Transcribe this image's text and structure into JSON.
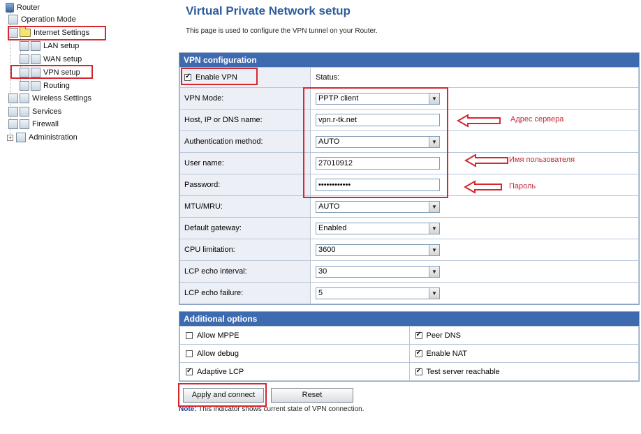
{
  "sidebar": {
    "items": [
      {
        "label": "Router",
        "icon": "router-icon"
      },
      {
        "label": "Operation Mode",
        "icon": "page-icon"
      },
      {
        "label": "Internet Settings",
        "icon": "folder-icon"
      },
      {
        "label": "LAN setup",
        "icon": "page-icon"
      },
      {
        "label": "WAN setup",
        "icon": "page-icon"
      },
      {
        "label": "VPN setup",
        "icon": "page-icon"
      },
      {
        "label": "Routing",
        "icon": "page-icon"
      },
      {
        "label": "Wireless Settings",
        "icon": "page-icon"
      },
      {
        "label": "Services",
        "icon": "page-icon"
      },
      {
        "label": "Firewall",
        "icon": "page-icon"
      },
      {
        "label": "Administration",
        "icon": "page-icon"
      }
    ],
    "expand_glyph": "+"
  },
  "page": {
    "title": "Virtual Private Network setup",
    "intro": "This page is used to configure the VPN tunnel on your Router."
  },
  "vpn": {
    "header": "VPN configuration",
    "enable_label": "Enable VPN",
    "enable_checked": true,
    "status_label": "Status:",
    "rows": [
      {
        "label": "VPN Mode:",
        "type": "select",
        "value": "PPTP client"
      },
      {
        "label": "Host, IP or DNS name:",
        "type": "text",
        "value": "vpn.r-tk.net"
      },
      {
        "label": "Authentication method:",
        "type": "select",
        "value": "AUTO"
      },
      {
        "label": "User name:",
        "type": "text",
        "value": "27010912"
      },
      {
        "label": "Password:",
        "type": "text",
        "value": "••••••••••••"
      },
      {
        "label": "MTU/MRU:",
        "type": "select",
        "value": "AUTO"
      },
      {
        "label": "Default gateway:",
        "type": "select",
        "value": "Enabled"
      },
      {
        "label": "CPU limitation:",
        "type": "select",
        "value": "3600"
      },
      {
        "label": "LCP echo interval:",
        "type": "select",
        "value": "30"
      },
      {
        "label": "LCP echo failure:",
        "type": "select",
        "value": "5"
      }
    ],
    "arrow_glyph": "▼"
  },
  "additional": {
    "header": "Additional options",
    "options": [
      {
        "label": "Allow MPPE",
        "checked": false
      },
      {
        "label": "Peer DNS",
        "checked": true
      },
      {
        "label": "Allow debug",
        "checked": false
      },
      {
        "label": "Enable NAT",
        "checked": true
      },
      {
        "label": "Adaptive LCP",
        "checked": true
      },
      {
        "label": "Test server reachable",
        "checked": true
      }
    ]
  },
  "buttons": {
    "apply": "Apply and connect",
    "reset": "Reset"
  },
  "note": {
    "prefix": "Note:",
    "text": "This indicator shows current state of VPN connection."
  },
  "annotations": {
    "server": "Адрес сервера",
    "username": "Имя пользователя",
    "password": "Пароль"
  },
  "colors": {
    "annotation_red": "#d8262f",
    "header_blue": "#3e6bb0",
    "title_blue": "#2f5d9e"
  }
}
